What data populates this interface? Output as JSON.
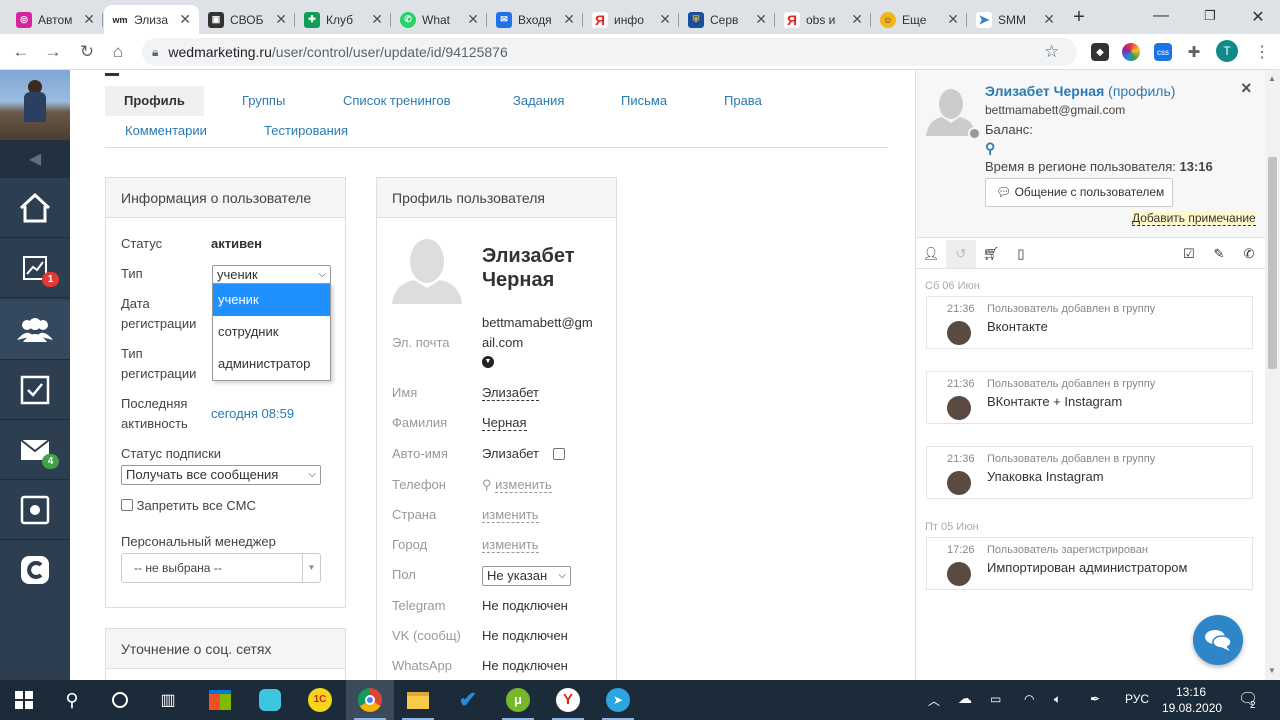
{
  "browser": {
    "tabs": [
      {
        "label": "Автом",
        "fav": "instagram-icon",
        "color": "#d6249f"
      },
      {
        "label": "Элиза",
        "fav": "wm-icon",
        "color": "#222222"
      },
      {
        "label": "СВОБ",
        "fav": "app-icon",
        "color": "#333333"
      },
      {
        "label": "Клуб",
        "fav": "sheets-icon",
        "color": "#0f9d58"
      },
      {
        "label": "What",
        "fav": "whatsapp-icon",
        "color": "#25d366"
      },
      {
        "label": "Входя",
        "fav": "mail-icon",
        "color": "#1e73e8"
      },
      {
        "label": "инфо",
        "fav": "yandex-icon",
        "color": "#e52620"
      },
      {
        "label": "Серв",
        "fav": "shield-icon",
        "color": "#1a4fa0"
      },
      {
        "label": "obs и",
        "fav": "yandex-icon",
        "color": "#e52620"
      },
      {
        "label": "Еще",
        "fav": "face-icon",
        "color": "#f2b518"
      },
      {
        "label": "SMM",
        "fav": "plane-icon",
        "color": "#3b82c4"
      }
    ],
    "new_tab": "+",
    "url_domain": "wedmarketing.ru",
    "url_path": "/user/control/user/update/id/94125876",
    "profile_initial": "T"
  },
  "sidebar": {
    "badges": {
      "stats": "1",
      "mail": "4"
    }
  },
  "nav_tabs": [
    "Профиль",
    "Группы",
    "Список тренингов",
    "Задания",
    "Письма",
    "Права",
    "Комментарии",
    "Тестирования"
  ],
  "user_info": {
    "title": "Информация о пользователе",
    "status_label": "Статус",
    "status_value": "активен",
    "type_label": "Тип",
    "type_value": "ученик",
    "type_options": [
      "ученик",
      "сотрудник",
      "администратор"
    ],
    "reg_date_label_1": "Дата",
    "reg_date_label_2": "регистрации",
    "reg_type_label_1": "Тип",
    "reg_type_label_2": "регистрации",
    "last_active_label_1": "Последняя",
    "last_active_label_2": "активность",
    "last_active_value": "сегодня 08:59",
    "subscription_label": "Статус подписки",
    "subscription_value": "Получать все сообщения",
    "sms_label": "Запретить все СМС",
    "manager_label": "Персональный менеджер",
    "manager_value": "-- не выбрана --"
  },
  "social_panel": {
    "title": "Уточнение о соц. сетях"
  },
  "profile": {
    "title": "Профиль пользователя",
    "name_line1": "Элизабет",
    "name_line2": "Черная",
    "email_label": "Эл. почта",
    "email_line1": "bettmamabett@gm",
    "email_line2": "ail.com",
    "first_name_label": "Имя",
    "first_name": "Элизабет",
    "last_name_label": "Фамилия",
    "last_name": "Черная",
    "auto_name_label": "Авто-имя",
    "auto_name": "Элизабет",
    "phone_label": "Телефон",
    "phone_action": "изменить",
    "country_label": "Страна",
    "country_action": "изменить",
    "city_label": "Город",
    "city_action": "изменить",
    "gender_label": "Пол",
    "gender_value": "Не указан",
    "telegram_label": "Telegram",
    "telegram_value": "Не подключен",
    "vk_label": "VK (сообщ)",
    "vk_value": "Не подключен",
    "whatsapp_label": "WhatsApp",
    "whatsapp_value": "Не подключен"
  },
  "right_panel": {
    "name": "Элизабет Черная",
    "profile_link": "(профиль)",
    "email": "bettmamabett@gmail.com",
    "balance_label": "Баланс:",
    "time_label": "Время в регионе пользователя:",
    "time_value": "13:16",
    "chat_button": "Общение с пользователем",
    "add_note": "Добавить примечание",
    "close": "×"
  },
  "timeline": {
    "day1": "Сб 06 Июн",
    "day2": "Пт 05 Июн",
    "events": [
      {
        "time": "21:36",
        "desc": "Пользователь добавлен в группу",
        "text": "Вконтакте"
      },
      {
        "time": "21:36",
        "desc": "Пользователь добавлен в группу",
        "text": "ВКонтакте + Instagram"
      },
      {
        "time": "21:36",
        "desc": "Пользователь добавлен в группу",
        "text": "Упаковка Instagram"
      },
      {
        "time": "17:26",
        "desc": "Пользователь зарегистрирован",
        "text": "Импортирован администратором"
      }
    ]
  },
  "taskbar": {
    "lang": "РУС",
    "time": "13:16",
    "date": "19.08.2020",
    "notif_count": "2"
  }
}
